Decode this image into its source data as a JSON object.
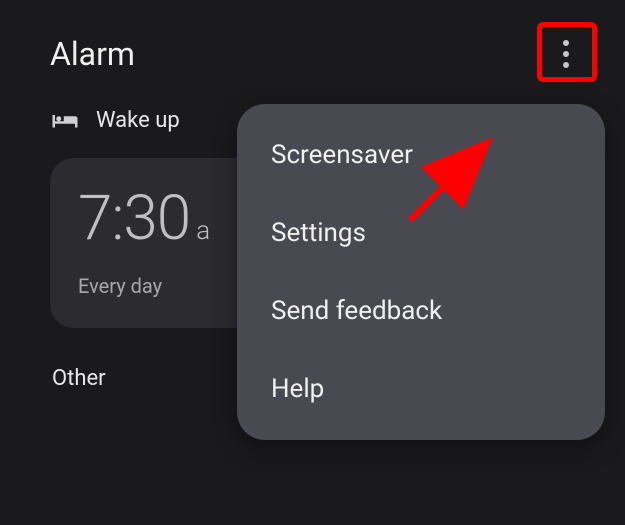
{
  "header": {
    "title": "Alarm"
  },
  "wakeup": {
    "section_label": "Wake up",
    "time": "7:30",
    "ampm": "a",
    "schedule": "Every day"
  },
  "other": {
    "label": "Other"
  },
  "menu": {
    "items": {
      "0": {
        "label": "Screensaver"
      },
      "1": {
        "label": "Settings"
      },
      "2": {
        "label": "Send feedback"
      },
      "3": {
        "label": "Help"
      }
    }
  }
}
